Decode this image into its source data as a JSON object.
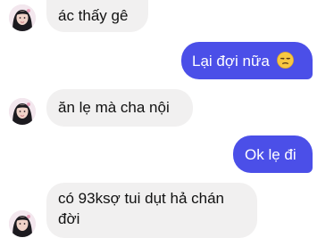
{
  "colors": {
    "incoming_bg": "#f1f0f0",
    "outgoing_bg": "#4b4fe8",
    "outgoing_text": "#ffffff",
    "incoming_text": "#111111"
  },
  "messages": [
    {
      "side": "in",
      "text": "ác thấy gê"
    },
    {
      "side": "out",
      "text": "Lại đợi nữa",
      "emoji": "unamused-face-icon"
    },
    {
      "side": "in",
      "text": "ăn lẹ mà cha nội"
    },
    {
      "side": "out",
      "text": "Ok lẹ đi"
    },
    {
      "side": "in",
      "lines": [
        "có 93ksợ tui dụt hả chán",
        "đời"
      ]
    }
  ]
}
